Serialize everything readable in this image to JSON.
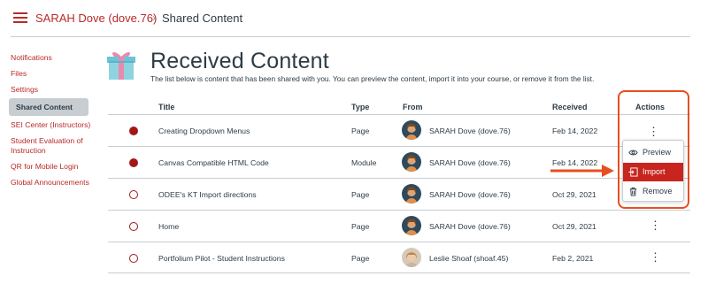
{
  "breadcrumb": {
    "course": "SARAH Dove (dove.76)",
    "separator": "›",
    "current": "Shared Content"
  },
  "sidebar": {
    "items": [
      {
        "label": "Notifications"
      },
      {
        "label": "Files"
      },
      {
        "label": "Settings"
      },
      {
        "label": "Shared Content",
        "active": true
      },
      {
        "label": "SEI Center (Instructors)"
      },
      {
        "label": "Student Evaluation of Instruction"
      },
      {
        "label": "QR for Mobile Login"
      },
      {
        "label": "Global Announcements"
      }
    ]
  },
  "header": {
    "title": "Received Content",
    "description": "The list below is content that has been shared with you. You can preview the content, import it into your course, or remove it from the list."
  },
  "table": {
    "columns": [
      "Title",
      "Type",
      "From",
      "Received",
      "Actions"
    ],
    "rows": [
      {
        "read": false,
        "title": "Creating Dropdown Menus",
        "type": "Page",
        "from": "SARAH Dove (dove.76)",
        "received": "Feb 14, 2022"
      },
      {
        "read": false,
        "title": "Canvas Compatible HTML Code",
        "type": "Module",
        "from": "SARAH Dove (dove.76)",
        "received": "Feb 14, 2022"
      },
      {
        "read": true,
        "title": "ODEE's KT Import directions",
        "type": "Page",
        "from": "SARAH Dove (dove.76)",
        "received": "Oct 29, 2021"
      },
      {
        "read": true,
        "title": "Home",
        "type": "Page",
        "from": "SARAH Dove (dove.76)",
        "received": "Oct 29, 2021"
      },
      {
        "read": true,
        "title": "Portfolium Pilot - Student Instructions",
        "type": "Page",
        "from": "Leslie Shoaf (shoaf.45)",
        "received": "Feb 2, 2021"
      }
    ]
  },
  "action_menu": {
    "items": [
      {
        "label": "Preview",
        "icon": "eye-icon"
      },
      {
        "label": "Import",
        "icon": "import-icon",
        "selected": true
      },
      {
        "label": "Remove",
        "icon": "trash-icon"
      }
    ]
  },
  "colors": {
    "brand_red": "#b82a2a",
    "highlight_orange": "#e84e20",
    "menu_selected": "#c7251e"
  }
}
